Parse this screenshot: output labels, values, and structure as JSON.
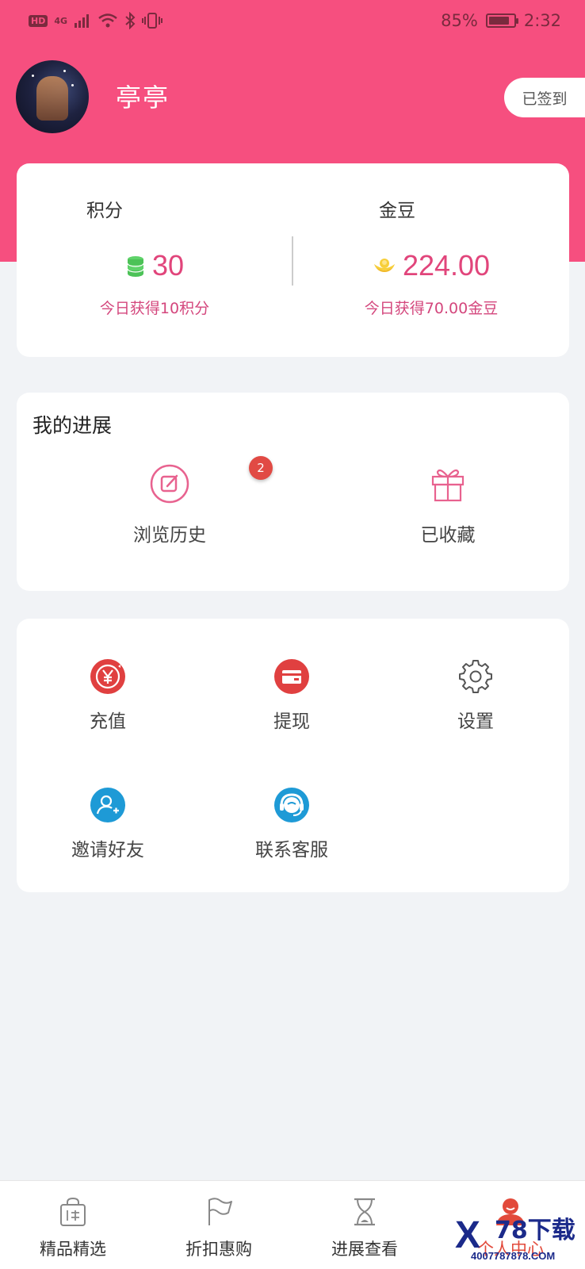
{
  "status_bar": {
    "left_badges": [
      "HD",
      "4G"
    ],
    "battery": "85%",
    "battery_level": 0.85,
    "time": "2:32"
  },
  "profile": {
    "username": "亭亭",
    "checkin_label": "已签到"
  },
  "points": {
    "score": {
      "title": "积分",
      "value": "30",
      "today": "今日获得10积分",
      "icon": "coin-stack-icon"
    },
    "gold": {
      "title": "金豆",
      "value": "224.00",
      "today": "今日获得70.00金豆",
      "icon": "gold-ingot-icon"
    }
  },
  "progress": {
    "title": "我的进展",
    "items": [
      {
        "label": "浏览历史",
        "icon": "edit-icon",
        "badge": "2"
      },
      {
        "label": "已收藏",
        "icon": "gift-icon"
      }
    ]
  },
  "tools": [
    {
      "label": "充值",
      "icon": "yuan-icon"
    },
    {
      "label": "提现",
      "icon": "card-icon"
    },
    {
      "label": "设置",
      "icon": "gear-icon"
    },
    {
      "label": "邀请好友",
      "icon": "add-user-icon"
    },
    {
      "label": "联系客服",
      "icon": "headset-icon"
    }
  ],
  "tabbar": [
    {
      "label": "精品精选",
      "icon": "bag-icon"
    },
    {
      "label": "折扣惠购",
      "icon": "flag-icon"
    },
    {
      "label": "进展查看",
      "icon": "hourglass-icon"
    },
    {
      "label": "个人中心",
      "icon": "person-icon",
      "active": true
    }
  ],
  "watermark": {
    "mark": "X",
    "text": "78下载",
    "url": "4007787878.COM"
  },
  "colors": {
    "brand": "#f64f7f",
    "accent_text": "#e1457b",
    "active_tab": "#e24a3b",
    "page_bg": "#f1f3f6"
  }
}
